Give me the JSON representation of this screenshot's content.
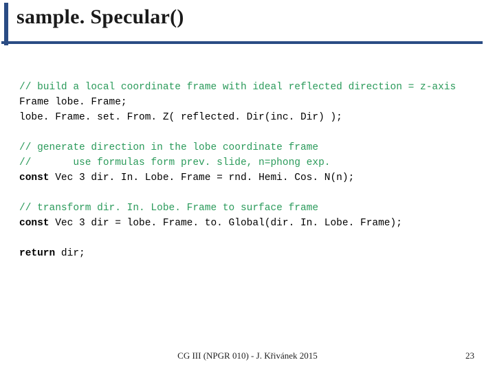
{
  "title": "sample. Specular()",
  "code": {
    "c1": "// build a local coordinate frame with ideal reflected direction = z-axis",
    "l1": "Frame lobe. Frame;",
    "l2": "lobe. Frame. set. From. Z( reflected. Dir(inc. Dir) );",
    "c2": "// generate direction in the lobe coordinate frame",
    "c3": "//       use formulas form prev. slide, n=phong exp.",
    "l3_a": "const",
    "l3_b": " Vec 3 dir. In. Lobe. Frame = rnd. Hemi. Cos. N(n);",
    "c4": "// transform dir. In. Lobe. Frame to surface frame",
    "l4_a": "const",
    "l4_b": " Vec 3 dir = lobe. Frame. to. Global(dir. In. Lobe. Frame);",
    "l5_a": "return",
    "l5_b": " dir;"
  },
  "footer": "CG III (NPGR 010) - J. Křivánek 2015",
  "page": "23"
}
